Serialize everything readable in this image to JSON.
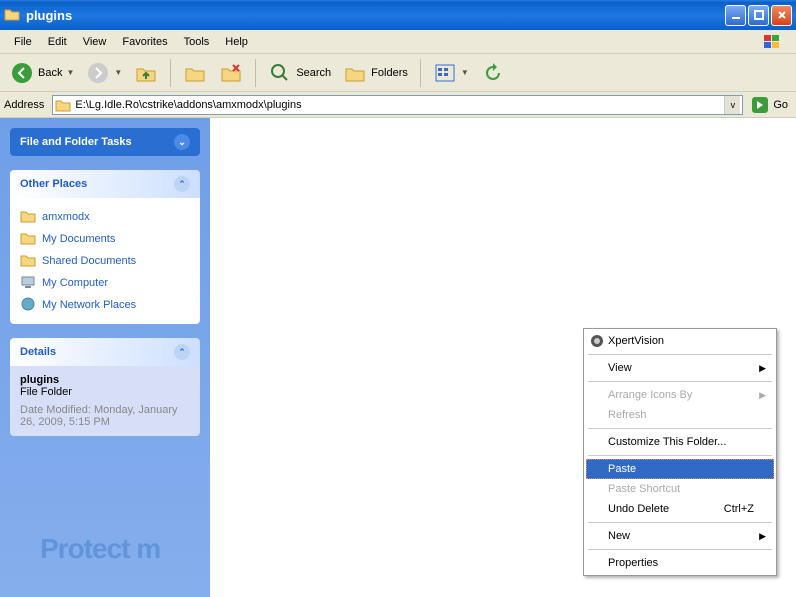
{
  "titlebar": {
    "title": "plugins"
  },
  "menu": {
    "file": "File",
    "edit": "Edit",
    "view": "View",
    "favorites": "Favorites",
    "tools": "Tools",
    "help": "Help"
  },
  "toolbar": {
    "back": "Back",
    "search": "Search",
    "folders": "Folders"
  },
  "address": {
    "label": "Address",
    "path": "E:\\Lg.Idle.Ro\\cstrike\\addons\\amxmodx\\plugins",
    "go": "Go"
  },
  "sidebar": {
    "tasks_title": "File and Folder Tasks",
    "other_title": "Other Places",
    "other": [
      {
        "label": "amxmodx"
      },
      {
        "label": "My Documents"
      },
      {
        "label": "Shared Documents"
      },
      {
        "label": "My Computer"
      },
      {
        "label": "My Network Places"
      }
    ],
    "details_title": "Details",
    "details": {
      "name": "plugins",
      "type": "File Folder",
      "modified": "Date Modified: Monday, January 26, 2009, 5:15 PM"
    }
  },
  "watermark": "Protect m",
  "context": {
    "xpert": "XpertVision",
    "view": "View",
    "arrange": "Arrange Icons By",
    "refresh": "Refresh",
    "customize": "Customize This Folder...",
    "paste": "Paste",
    "paste_shortcut": "Paste Shortcut",
    "undo": "Undo Delete",
    "undo_key": "Ctrl+Z",
    "new": "New",
    "properties": "Properties"
  }
}
